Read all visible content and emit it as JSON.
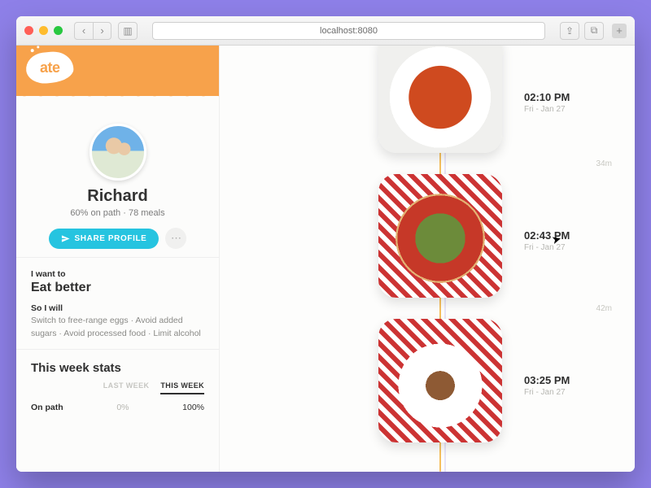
{
  "browser": {
    "url": "localhost:8080"
  },
  "brand": {
    "name": "ate"
  },
  "profile": {
    "name": "Richard",
    "substat": "60% on path · 78 meals",
    "share_label": "SHARE PROFILE"
  },
  "goal": {
    "kicker": "I want to",
    "title": "Eat better",
    "habits_kicker": "So I will",
    "habits": "Switch to free-range eggs · Avoid added sugars · Avoid processed food · Limit alcohol"
  },
  "stats": {
    "heading": "This week stats",
    "tab_last": "LAST WEEK",
    "tab_this": "THIS WEEK",
    "row1_label": "On path",
    "row1_last": "0%",
    "row1_this": "100%"
  },
  "timeline": {
    "items": [
      {
        "time": "02:10 PM",
        "date": "Fri - Jan 27"
      },
      {
        "time": "02:43 PM",
        "date": "Fri - Jan 27"
      },
      {
        "time": "03:25 PM",
        "date": "Fri - Jan 27"
      }
    ],
    "gaps": [
      "34m",
      "42m"
    ]
  }
}
